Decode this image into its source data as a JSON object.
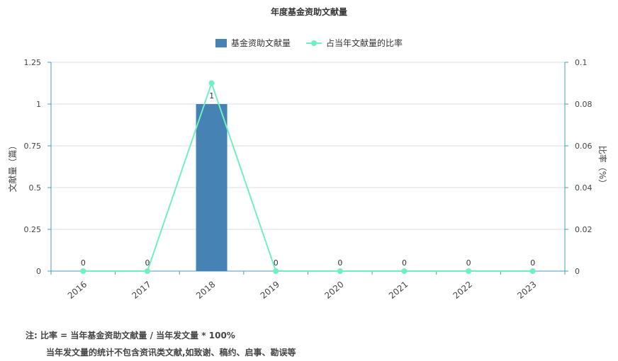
{
  "chart_data": {
    "type": "bar",
    "title": "年度基金资助文献量",
    "categories": [
      "2016",
      "2017",
      "2018",
      "2019",
      "2020",
      "2021",
      "2022",
      "2023"
    ],
    "series": [
      {
        "name": "基金资助文献量",
        "type": "bar",
        "axis": "left",
        "values": [
          0,
          0,
          1,
          0,
          0,
          0,
          0,
          0
        ],
        "labels": [
          "0",
          "0",
          "1",
          "0",
          "0",
          "0",
          "0",
          "0"
        ],
        "color": "#4682b4"
      },
      {
        "name": "占当年文献量的比率",
        "type": "line",
        "axis": "right",
        "values": [
          0,
          0,
          0.09,
          0,
          0,
          0,
          0,
          0
        ],
        "color": "#6ff0c0"
      }
    ],
    "ylabel": "文献量（篇）",
    "ylabel_right": "比率（%）",
    "ylim": [
      0,
      1.25
    ],
    "ylim_right": [
      0,
      0.1
    ],
    "yticks": [
      "0",
      "0.25",
      "0.5",
      "0.75",
      "1",
      "1.25"
    ],
    "yticks_right": [
      "0",
      "0.02",
      "0.04",
      "0.06",
      "0.08",
      "0.1"
    ],
    "grid": true,
    "legend": "top-center"
  },
  "note": {
    "line1": "注:   比率 = 当年基金资助文献量 / 当年发文量 * 100%",
    "line2": "当年发文量的统计不包含资讯类文献,如致谢、稿约、启事、勘误等"
  }
}
